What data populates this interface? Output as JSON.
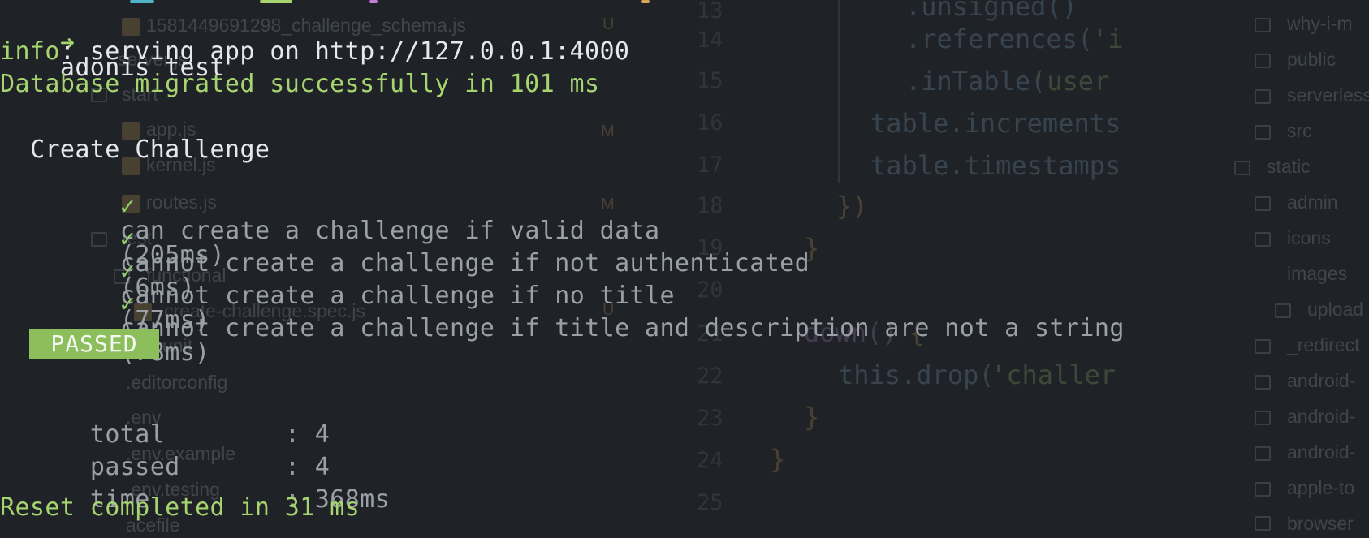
{
  "terminal": {
    "prompt_arrow": "➜",
    "command": "adonis test",
    "info_prefix": "info",
    "info_message": ": serving app on http://127.0.0.1:4000",
    "db_migrated": "Database migrated successfully in 101 ms",
    "suite_title": "Create Challenge",
    "check_glyph": "✓",
    "tests": [
      {
        "name": "can create a challenge if valid data",
        "duration": "(205ms)"
      },
      {
        "name": "cannot create a challenge if not authenticated",
        "duration": "(6ms)"
      },
      {
        "name": "cannot create a challenge if no title",
        "duration": "(77ms)"
      },
      {
        "name": "cannot create a challenge if title and description are not a string",
        "duration": "(78ms)"
      }
    ],
    "status_badge": "PASSED",
    "summary": {
      "total_label": "total",
      "total_value": ": 4",
      "passed_label": "passed",
      "passed_value": ": 4",
      "time_label": "time",
      "time_value": ": 368ms"
    },
    "reset": "Reset completed in 31 ms"
  },
  "background": {
    "file_tree_left": [
      "1581449691298_challenge_schema.js",
      "server.js",
      "start",
      "app.js",
      "kernel.js",
      "routes.js",
      "test",
      "functional",
      "create-challenge.spec.js",
      "unit",
      ".editorconfig",
      ".env",
      ".env.example",
      ".env.testing",
      "acefile"
    ],
    "git_markers": [
      "U",
      "M",
      "M",
      "U"
    ],
    "line_numbers": [
      "13",
      "14",
      "15",
      "16",
      "17",
      "18",
      "19",
      "20",
      "21",
      "22",
      "23",
      "24",
      "25"
    ],
    "code": {
      "l13": ".unsigned()",
      "l14a": ".references(",
      "l14b": "'i",
      "l15a": ".inTable(",
      "l15b": "'user",
      "l16": "table.increments",
      "l17": "table.timestamps",
      "l18": "})",
      "l19": "}",
      "l21a": "down()",
      "l21b": " {",
      "l22a": "this.drop(",
      "l22b": "'challer",
      "l23": "}",
      "l24": "}"
    },
    "file_tree_right": [
      "why-i-m",
      "public",
      "serverless",
      "src",
      "static",
      "admin",
      "icons",
      "images",
      "upload",
      "_redirect",
      "android-",
      "android-",
      "android-",
      "apple-to",
      "browser"
    ]
  }
}
